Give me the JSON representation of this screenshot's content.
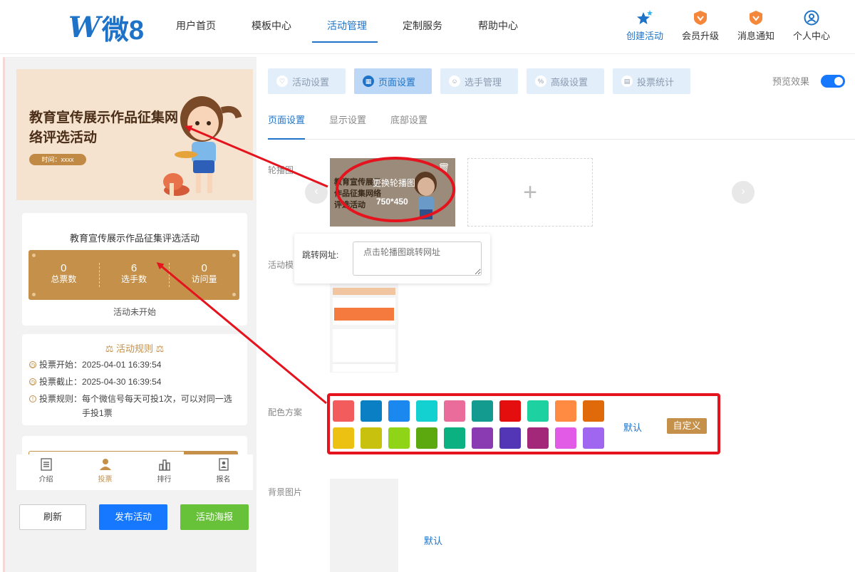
{
  "logo": {
    "mark": "W",
    "text": "微8"
  },
  "nav": {
    "items": [
      "用户首页",
      "模板中心",
      "活动管理",
      "定制服务",
      "帮助中心"
    ],
    "active": "活动管理"
  },
  "tools": [
    {
      "label": "创建活动",
      "icon": "stars-icon"
    },
    {
      "label": "会员升级",
      "icon": "vip-badge-icon"
    },
    {
      "label": "消息通知",
      "icon": "notice-badge-icon"
    },
    {
      "label": "个人中心",
      "icon": "user-icon"
    }
  ],
  "phone": {
    "banner": {
      "title": "教育宣传展示作品征集网络评选活动",
      "time": "时间：xxxx"
    },
    "card": {
      "title": "教育宣传展示作品征集评选活动",
      "stats": [
        {
          "value": "0",
          "label": "总票数"
        },
        {
          "value": "6",
          "label": "选手数"
        },
        {
          "value": "0",
          "label": "访问量"
        }
      ],
      "status": "活动未开始"
    },
    "rules": {
      "title": "活动规则",
      "items": [
        {
          "key": "投票开始：",
          "value": "2025-04-01 16:39:54"
        },
        {
          "key": "投票截止：",
          "value": "2025-04-30 16:39:54"
        },
        {
          "key": "投票规则：",
          "value": "每个微信号每天可投1次，可以对同一选手投1票"
        }
      ]
    },
    "tabbar": [
      {
        "label": "介绍",
        "icon": "document-icon"
      },
      {
        "label": "投票",
        "icon": "person-icon"
      },
      {
        "label": "排行",
        "icon": "bar-chart-icon"
      },
      {
        "label": "报名",
        "icon": "signup-icon"
      }
    ],
    "buttons": {
      "refresh": "刷新",
      "publish": "发布活动",
      "poster": "活动海报"
    }
  },
  "tabs": [
    {
      "label": "活动设置",
      "icon": "heart-icon"
    },
    {
      "label": "页面设置",
      "icon": "layout-icon"
    },
    {
      "label": "选手管理",
      "icon": "player-icon"
    },
    {
      "label": "高级设置",
      "icon": "percent-icon"
    },
    {
      "label": "投票统计",
      "icon": "stats-icon"
    }
  ],
  "activeTab": "页面设置",
  "preview": {
    "label": "预览效果",
    "on": true
  },
  "subtabs": [
    "页面设置",
    "显示设置",
    "底部设置"
  ],
  "fields": {
    "carousel": "轮播图",
    "template": "活动模",
    "palette": "配色方案",
    "background": "背景图片"
  },
  "carousel": {
    "thumb_title": "教育宣传展示作品征集网络评选活动",
    "change": "更换轮播图",
    "size": "750*450"
  },
  "popover": {
    "label": "跳转网址:",
    "placeholder": "点击轮播图跳转网址"
  },
  "palette": {
    "colors": [
      "#f25c5c",
      "#0a7fc4",
      "#1b88f0",
      "#13d1d0",
      "#e96c9b",
      "#139b8f",
      "#e50e0e",
      "#1ed1a0",
      "#ff8a42",
      "#e06a0a",
      "#ecc112",
      "#c8c10e",
      "#8fd417",
      "#5ca80f",
      "#0bb180",
      "#8a3bb2",
      "#5236b5",
      "#a3287a",
      "#e15be6",
      "#a066f0"
    ],
    "default": "默认",
    "custom": "自定义"
  },
  "background": {
    "default": "默认"
  },
  "colors": {
    "accent": "#1e73c8",
    "gold": "#c4904a",
    "annotation": "#e5131d"
  }
}
